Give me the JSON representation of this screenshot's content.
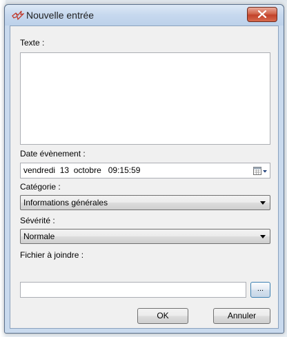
{
  "window": {
    "title": "Nouvelle entrée",
    "app_icon": "bird-logo-icon",
    "close_icon": "close-icon"
  },
  "form": {
    "text_label": "Texte :",
    "text_value": "",
    "date_label": "Date évènement :",
    "date_value": "vendredi  13  octobre   09:15:59",
    "date_icon": "calendar-icon",
    "category_label": "Catégorie :",
    "category_value": "Informations générales",
    "severity_label": "Sévérité :",
    "severity_value": "Normale",
    "file_label": "Fichier à joindre :",
    "file_value": "",
    "browse_label": "..."
  },
  "buttons": {
    "ok": "OK",
    "cancel": "Annuler"
  },
  "colors": {
    "title_bar": "#c6d8ee",
    "close_button": "#c2422a",
    "client_bg": "#f0f0f0"
  }
}
